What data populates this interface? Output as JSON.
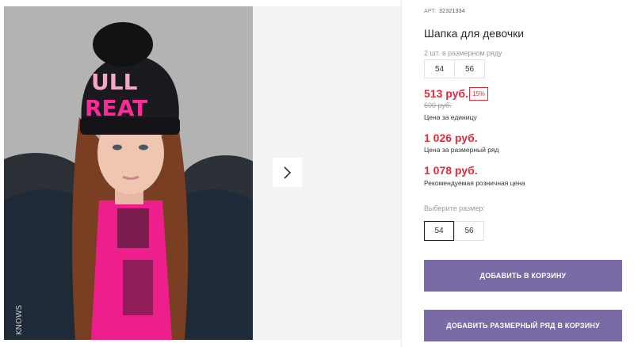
{
  "product": {
    "sku_label": "АРТ:",
    "sku": "32321334",
    "title": "Шапка для девочки",
    "pack_label": "2 шт. в размерном ряду",
    "pack_sizes": [
      "54",
      "56"
    ],
    "price": "513 руб.",
    "discount": "15%",
    "old_price": "600 руб.",
    "unit_price_caption": "Цена за единицу",
    "pack_price": "1 026 руб.",
    "pack_price_caption": "Цена за размерный ряд",
    "retail_price": "1 078 руб.",
    "retail_price_caption": "Рекомендуемая розничная цена",
    "choose_size_label": "Выберите размер:",
    "size_options": [
      "54",
      "56"
    ],
    "selected_size": "54",
    "add_to_cart": "ДОБАВИТЬ В КОРЗИНУ",
    "add_pack_to_cart": "ДОБАВИТЬ РАЗМЕРНЫЙ РЯД В КОРЗИНУ"
  },
  "gallery": {
    "next_icon": "chevron-right-icon"
  },
  "colors": {
    "price_red": "#e32a3b",
    "button_purple": "#7a6aa6"
  }
}
